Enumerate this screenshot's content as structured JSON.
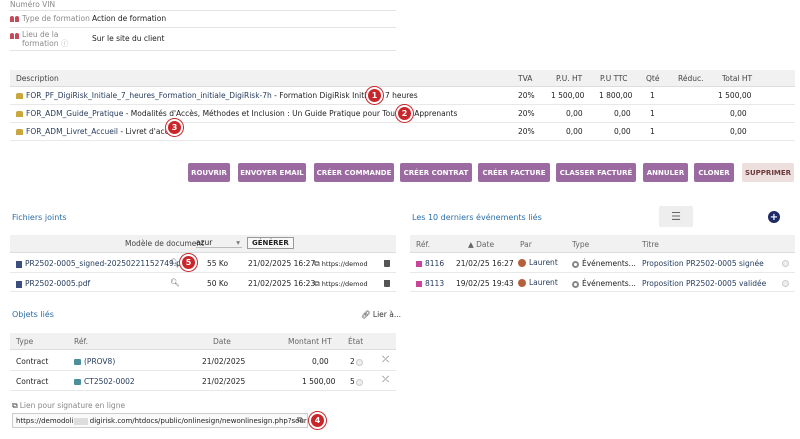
{
  "fields": {
    "vin_label": "Numéro VIN",
    "type_label": "Type de formation",
    "type_value": "Action de formation",
    "lieu_label1": "Lieu de la",
    "lieu_label2": "formation",
    "lieu_value": "Sur le site du client"
  },
  "lines": {
    "headers": [
      "Description",
      "TVA",
      "P.U. HT",
      "P.U TTC",
      "Qté",
      "Réduc.",
      "Total HT"
    ],
    "rows": [
      {
        "ref": "FOR_PF_DigiRisk_Initiale_7_heures_Formation_initiale_DigiRisk-7h",
        "desc": " - Formation DigiRisk Initiale - 7 heures",
        "tva": "20%",
        "puht": "1 500,00",
        "puttc": "1 800,00",
        "qty": "1",
        "total": "1 500,00",
        "badge": "1"
      },
      {
        "ref": "FOR_ADM_Guide_Pratique",
        "desc": " - Modalités d'Accès, Méthodes et Inclusion : Un Guide Pratique pour Tous les Apprenants",
        "tva": "20%",
        "puht": "0,00",
        "puttc": "0,00",
        "qty": "1",
        "total": "0,00",
        "badge": "2"
      },
      {
        "ref": "FOR_ADM_Livret_Accueil",
        "desc": " - Livret d'accueil",
        "tva": "20%",
        "puht": "0,00",
        "puttc": "0,00",
        "qty": "1",
        "total": "0,00",
        "badge": "3"
      }
    ]
  },
  "buttons": [
    "ROUVRIR",
    "ENVOYER EMAIL",
    "CRÉER COMMANDE",
    "CRÉER CONTRAT",
    "CRÉER FACTURE",
    "CLASSER FACTURÉ",
    "ANNULER",
    "CLONER",
    "SUPPRIMER"
  ],
  "files": {
    "title": "Fichiers joints",
    "model_label": "Modèle de document",
    "model_value": "azur",
    "generate": "GÉNÉRER",
    "rows": [
      {
        "name": "PR2502-0005_signed-20250221152749.pdf",
        "size": "55 Ko",
        "date": "21/02/2025 16:27",
        "link": "https://demod",
        "badge": "5"
      },
      {
        "name": "PR2502-0005.pdf",
        "size": "50 Ko",
        "date": "21/02/2025 16:23",
        "link": "https://demod"
      }
    ]
  },
  "events": {
    "title": "Les 10 derniers événements liés",
    "headers": [
      "Réf.",
      "Date",
      "Par",
      "Type",
      "Titre"
    ],
    "rows": [
      {
        "ref": "8116",
        "date": "21/02/25 16:27",
        "by": "Laurent",
        "type": "Événements...",
        "title": "Proposition PR2502-0005 signée"
      },
      {
        "ref": "8113",
        "date": "19/02/25 19:43",
        "by": "Laurent",
        "type": "Événements...",
        "title": "Proposition PR2502-0005 validée"
      }
    ]
  },
  "linked": {
    "title": "Objets liés",
    "link_label": "Lier à...",
    "headers": [
      "Type",
      "Réf.",
      "Date",
      "Montant HT",
      "État"
    ],
    "rows": [
      {
        "type": "Contract",
        "ref": "(PROV8)",
        "date": "21/02/2025",
        "amount": "0,00",
        "state": "2"
      },
      {
        "type": "Contract",
        "ref": "CT2502-0002",
        "date": "21/02/2025",
        "amount": "1 500,00",
        "state": "5"
      }
    ]
  },
  "signature": {
    "label": "Lien pour signature en ligne",
    "url_start": "https://demodoli",
    "url_end": " digirisk.com/htdocs/public/onlinesign/newonlinesign.php?source=pro",
    "badge": "4"
  }
}
